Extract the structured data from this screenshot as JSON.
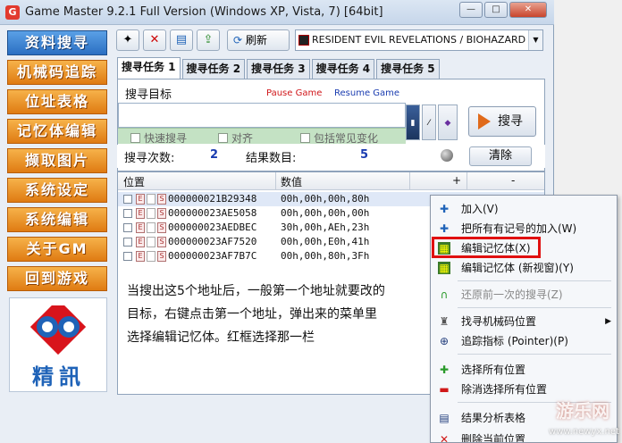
{
  "window": {
    "title": "Game Master 9.2.1 Full Version (Windows XP, Vista, 7) [64bit]",
    "buttons": {
      "minimize": "—",
      "maximize": "□",
      "close": "✕"
    }
  },
  "sidebar": {
    "items": [
      {
        "label": "资料搜寻"
      },
      {
        "label": "机械码追踪"
      },
      {
        "label": "位址表格"
      },
      {
        "label": "记忆体编辑"
      },
      {
        "label": "撷取图片"
      },
      {
        "label": "系统设定"
      },
      {
        "label": "系统编辑"
      },
      {
        "label": "关于GM"
      },
      {
        "label": "回到游戏"
      }
    ],
    "logo_text": "精訊"
  },
  "toolbar": {
    "refresh_label": "刷新",
    "process_name": "RESIDENT EVIL REVELATIONS / BIOHAZARD REVE"
  },
  "tabs": [
    {
      "label": "搜寻任务 1"
    },
    {
      "label": "搜寻任务 2"
    },
    {
      "label": "搜寻任务 3"
    },
    {
      "label": "搜寻任务 4"
    },
    {
      "label": "搜寻任务 5"
    }
  ],
  "search": {
    "target_label": "搜寻目标",
    "pause_game": "Pause Game",
    "resume_game": "Resume Game",
    "options": [
      {
        "label": "快速搜寻"
      },
      {
        "label": "对齐"
      },
      {
        "label": "包括常见变化"
      }
    ],
    "search_button": "搜寻"
  },
  "stats": {
    "search_count_label": "搜寻次数:",
    "search_count": "2",
    "result_count_label": "结果数目:",
    "result_count": "5",
    "clear_button": "清除"
  },
  "results": {
    "columns": {
      "address": "位置",
      "value": "数值",
      "plus": "+",
      "minus": "-"
    },
    "rows": [
      {
        "address": "000000021B29348",
        "value": "00h,00h,00h,80h"
      },
      {
        "address": "000000023AE5058",
        "value": "00h,00h,00h,00h"
      },
      {
        "address": "000000023AEDBEC",
        "value": "30h,00h,AEh,23h"
      },
      {
        "address": "000000023AF7520",
        "value": "00h,00h,E0h,41h"
      },
      {
        "address": "000000023AF7B7C",
        "value": "00h,00h,80h,3Fh"
      }
    ],
    "note": "当搜出这5个地址后，一般第一个地址就要改的目标，右键点击第一个地址，弹出来的菜单里选择编辑记忆体。红框选择那一栏"
  },
  "context_menu": {
    "items": [
      {
        "label": "加入(V)",
        "icon": "plus-icon"
      },
      {
        "label": "把所有有记号的加入(W)",
        "icon": "plus-icon"
      },
      {
        "label": "编辑记忆体(X)",
        "icon": "memory-edit-icon"
      },
      {
        "label": "编辑记忆体 (新视窗)(Y)",
        "icon": "memory-window-icon"
      },
      {
        "label": "还原前一次的搜寻(Z)",
        "icon": "undo-icon"
      },
      {
        "label": "找寻机械码位置",
        "icon": "machine-code-icon"
      },
      {
        "label": "追踪指标 (Pointer)(P)",
        "icon": "pointer-icon"
      },
      {
        "label": "选择所有位置",
        "icon": "select-all-icon"
      },
      {
        "label": "除消选择所有位置",
        "icon": "deselect-all-icon"
      },
      {
        "label": "结果分析表格",
        "icon": "table-icon"
      },
      {
        "label": "删除当前位置",
        "icon": "delete-icon"
      }
    ]
  },
  "watermark": {
    "text": "游乐网",
    "sub": "www.newyx.net"
  }
}
